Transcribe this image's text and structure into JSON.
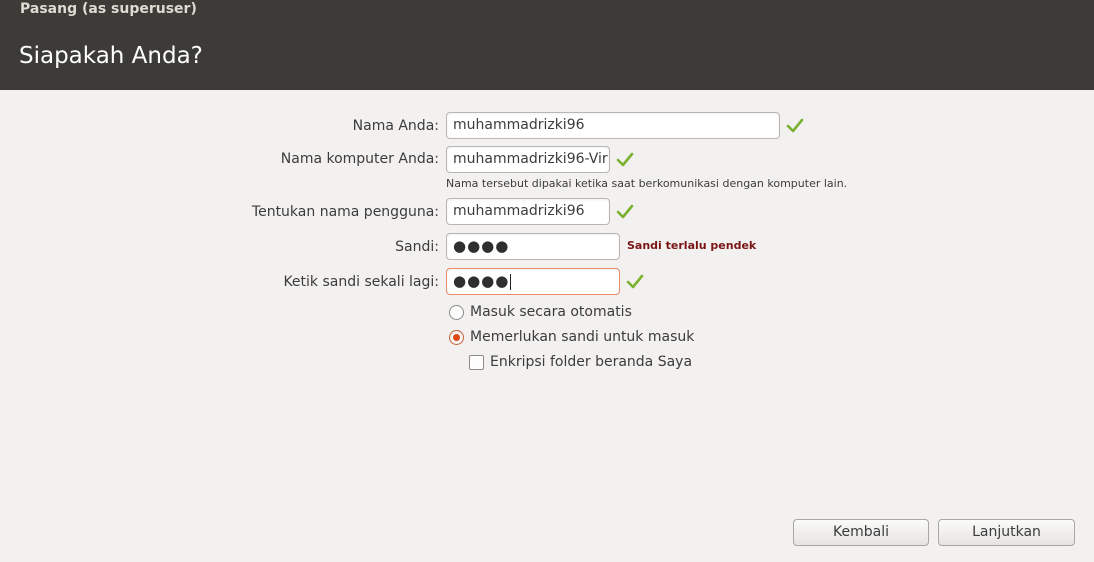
{
  "window": {
    "title": "Pasang (as superuser)"
  },
  "page": {
    "title": "Siapakah Anda?"
  },
  "form": {
    "name": {
      "label": "Nama Anda:",
      "value": "muhammadrizki96"
    },
    "computer": {
      "label": "Nama komputer Anda:",
      "value": "muhammadrizki96-Vir",
      "hint": "Nama tersebut dipakai ketika saat berkomunikasi dengan komputer lain."
    },
    "username": {
      "label": "Tentukan nama pengguna:",
      "value": "muhammadrizki96"
    },
    "password": {
      "label": "Sandi:",
      "value": "●●●●",
      "error": "Sandi terlalu pendek"
    },
    "confirm": {
      "label": "Ketik sandi sekali lagi:",
      "value": "●●●●"
    }
  },
  "options": {
    "auto_login": {
      "label": "Masuk secara otomatis",
      "selected": false
    },
    "require_password": {
      "label": "Memerlukan sandi untuk masuk",
      "selected": true
    },
    "encrypt_home": {
      "label": "Enkripsi folder beranda Saya",
      "checked": false
    }
  },
  "buttons": {
    "back": "Kembali",
    "continue": "Lanjutkan"
  },
  "colors": {
    "header": "#3c3b37",
    "accent": "#dd4814",
    "check": "#7ab22f",
    "error": "#7a1515"
  }
}
